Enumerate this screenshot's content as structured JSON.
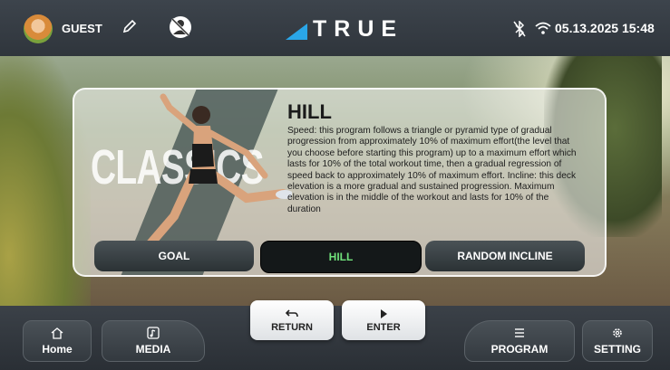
{
  "header": {
    "user": "GUEST",
    "brand": "TRUE",
    "datetime": "05.13.2025 15:48",
    "icons": [
      "avatar",
      "pencil-icon",
      "no-user-icon",
      "true-logo-icon",
      "bluetooth-icon",
      "wifi-icon"
    ]
  },
  "program": {
    "category_label": "CLASSICS",
    "title": "HILL",
    "description": "Speed: this program follows a triangle or pyramid type of gradual progression from approximately 10% of maximum effort(the level that you choose before starting this program) up to a maximum effort which lasts for 10% of the total workout time, then a gradual regression of speed back to approximately 10% of maximum effort. Incline: this deck elevation is a more gradual and sustained progression. Maximum elevation is in the middle of the workout and lasts for 10% of the duration",
    "options": [
      "GOAL",
      "HILL",
      "RANDOM INCLINE"
    ],
    "selected": "HILL"
  },
  "footer": {
    "home": "Home",
    "media": "MEDIA",
    "return": "RETURN",
    "enter": "ENTER",
    "program": "PROGRAM",
    "setting": "SETTING"
  },
  "colors": {
    "accent_green": "#6fe07a",
    "logo_blue": "#2aa6e8"
  }
}
